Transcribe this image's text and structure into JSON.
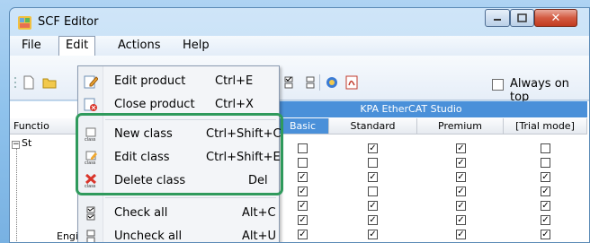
{
  "window": {
    "title": "SCF Editor",
    "caption_buttons": {
      "minimize": "minimize-icon",
      "maximize": "maximize-icon",
      "close": "✕"
    }
  },
  "menubar": {
    "file": "File",
    "edit": "Edit",
    "actions": "Actions",
    "help": "Help"
  },
  "toolbar": {
    "always_on_top_label": "Always on top",
    "always_on_top_checked": false
  },
  "grid": {
    "band_title": "KPA EtherCAT Studio",
    "function_header": "Functio",
    "columns": [
      "Basic",
      "Standard",
      "Premium",
      "[Trial mode]"
    ],
    "tree_root": "St",
    "rows": [
      {
        "label": "",
        "checks": [
          false,
          true,
          true,
          false
        ]
      },
      {
        "label": "",
        "checks": [
          false,
          false,
          true,
          false
        ]
      },
      {
        "label": "",
        "checks": [
          true,
          true,
          true,
          true
        ]
      },
      {
        "label": "",
        "checks": [
          true,
          false,
          true,
          true
        ]
      },
      {
        "label": "",
        "checks": [
          true,
          true,
          true,
          true
        ]
      },
      {
        "label": "",
        "checks": [
          true,
          true,
          true,
          true
        ]
      },
      {
        "label": "Engineering Unit Mapping",
        "checks": [
          true,
          true,
          true,
          true
        ]
      }
    ]
  },
  "edit_menu": {
    "items": [
      {
        "label": "Edit product",
        "shortcut": "Ctrl+E",
        "icon": "edit-product-icon"
      },
      {
        "label": "Close product",
        "shortcut": "Ctrl+X",
        "icon": "close-product-icon"
      },
      {
        "label": "New class",
        "shortcut": "Ctrl+Shift+C",
        "icon": "new-class-icon"
      },
      {
        "label": "Edit class",
        "shortcut": "Ctrl+Shift+E",
        "icon": "edit-class-icon"
      },
      {
        "label": "Delete class",
        "shortcut": "Del",
        "icon": "delete-class-icon"
      },
      {
        "label": "Check all",
        "shortcut": "Alt+C",
        "icon": "check-all-icon"
      },
      {
        "label": "Uncheck all",
        "shortcut": "Alt+U",
        "icon": "uncheck-all-icon"
      }
    ]
  },
  "colors": {
    "accent": "#4a90d9",
    "highlight_border": "#2f9a5c",
    "close_button": "#c13b20"
  }
}
